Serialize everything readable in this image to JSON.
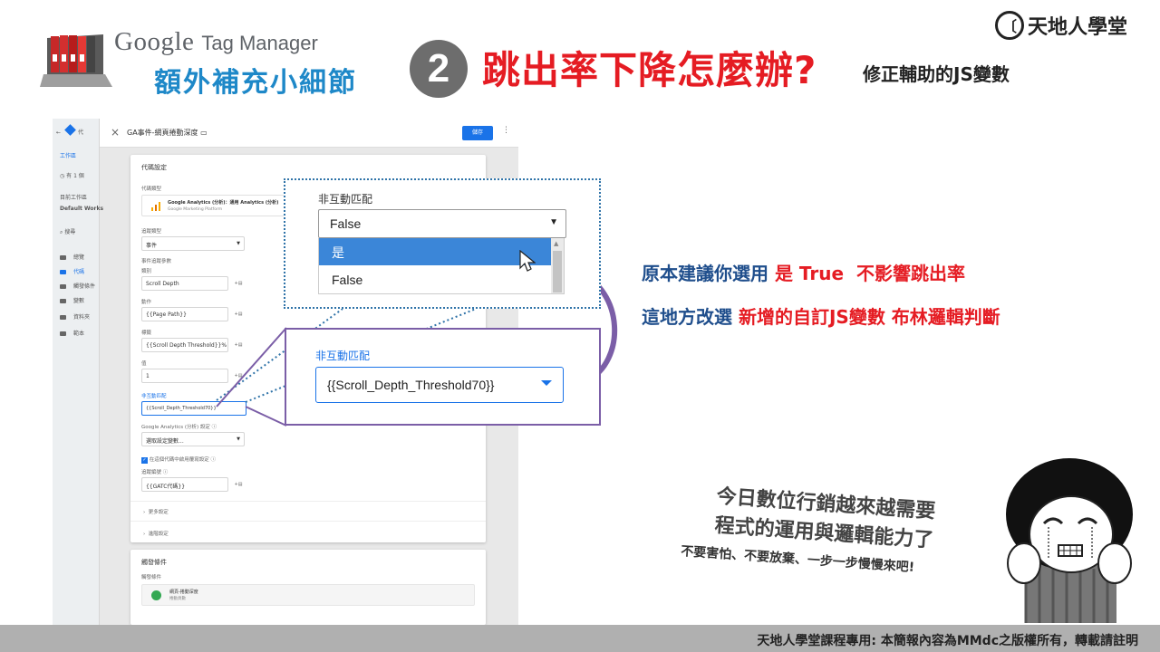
{
  "header": {
    "google": "Google",
    "tag_manager": "Tag Manager",
    "subtitle": "額外補充小細節",
    "step": "2",
    "title": "跳出率下降怎麼辦?",
    "title_sub": "修正輔助的JS變數",
    "brand_icon": "〔",
    "brand": "天地人學堂"
  },
  "screenshot": {
    "nav": {
      "menu_code": "代",
      "workspace": "工作區",
      "changes": "有 1 個",
      "current_ws": "目前工作區",
      "default_ws": "Default Works",
      "search": "搜尋",
      "items": [
        "總覽",
        "代碼",
        "觸發條件",
        "變數",
        "資料夾",
        "範本"
      ]
    },
    "topbar": {
      "close": "×",
      "tag_name": "GA事件-網頁捲動深度",
      "save": "儲存",
      "more": "⋮"
    },
    "card": {
      "title": "代碼設定",
      "tag_type_label": "代碼類型",
      "tag_type": "Google Analytics (分析)：通用 Analytics (分析)",
      "tag_type_sub": "Google Marketing Platform",
      "track_type_label": "追蹤類型",
      "track_type": "事件",
      "event_params_label": "事件追蹤參數",
      "category_label": "類別",
      "category": "Scroll Depth",
      "action_label": "動作",
      "action": "{{Page Path}}",
      "label_label": "標籤",
      "label": "{{Scroll Depth Threshold}}%",
      "value_label": "值",
      "value": "1",
      "non_interaction_label": "非互動匹配",
      "non_interaction": "{{Scroll_Depth_Threshold70}}",
      "ga_settings_label": "Google Analytics (分析) 設定",
      "ga_settings": "選取設定變數...",
      "override_label": "在這個代碼中啟用覆寫設定",
      "tracking_id_label": "追蹤編號",
      "tracking_id": "{{GATC代碼}}",
      "more_settings": "更多設定",
      "advanced_settings": "進階設定",
      "var_btn": "+▤"
    },
    "card2": {
      "title": "觸發條件",
      "sub": "觸發條件",
      "trigger_name": "網頁-捲動深度",
      "trigger_type": "捲動頁數"
    }
  },
  "zoom": {
    "label": "非互動匹配",
    "value": "False",
    "options": [
      "是",
      "False"
    ]
  },
  "new_field": {
    "label": "非互動匹配",
    "value": "{{Scroll_Depth_Threshold70}}"
  },
  "notes": {
    "line1_a": "原本建議你選用",
    "line1_b": "是 True",
    "line1_c": "不影響跳出率",
    "line2_a": "這地方改選",
    "line2_b": "新增的自訂JS變數 布林邏輯判斷"
  },
  "meme": {
    "line1": "今日數位行銷越來越需要",
    "line2": "程式的運用與邏輯能力了",
    "line3": "不要害怕、不要放棄、一步一步慢慢來吧!"
  },
  "footer": "天地人學堂課程專用: 本簡報內容為MMdc之版權所有，轉載請註明",
  "colors": {
    "accent_blue": "#1e88c8",
    "title_red": "#e51c23",
    "note_blue": "#1f4e8c",
    "gtm_blue": "#1a73e8",
    "purple": "#7b5ea7"
  }
}
